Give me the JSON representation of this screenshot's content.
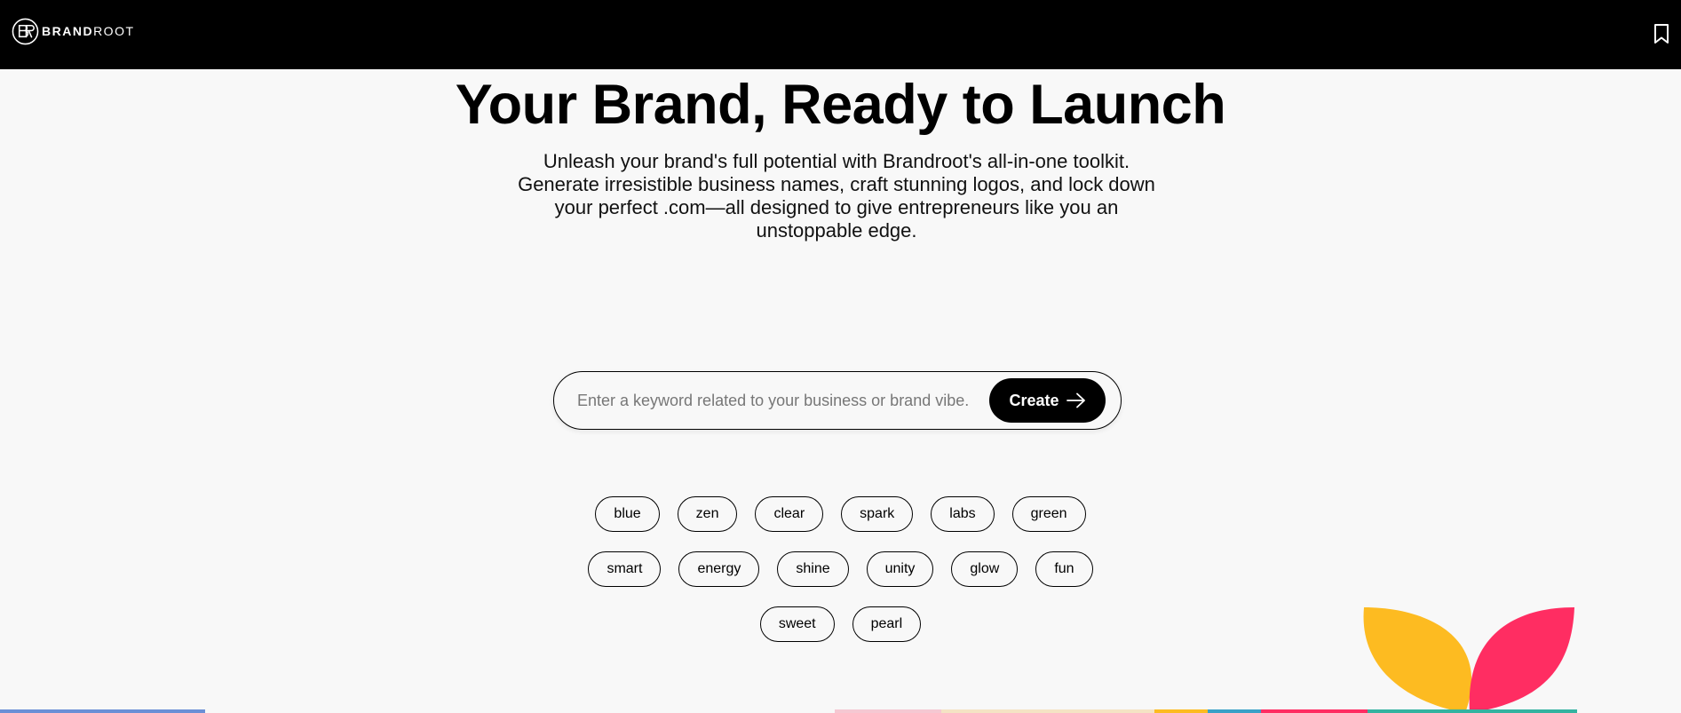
{
  "header": {
    "logo": {
      "bold": "BRAND",
      "light": "ROOT"
    },
    "bookmark_icon": "bookmark-icon"
  },
  "hero": {
    "title": "Your Brand, Ready to Launch",
    "subtitle": "Unleash your brand's full potential with Brandroot's all-in-one toolkit. Generate irresistible business names, craft stunning logos, and lock down your perfect .com—all designed to give entrepreneurs like you an unstoppable edge."
  },
  "search": {
    "placeholder": "Enter a keyword related to your business or brand vibe.",
    "value": "",
    "button_label": "Create",
    "button_icon": "arrow-right-icon"
  },
  "keywords": {
    "rows": [
      [
        "blue",
        "zen",
        "clear",
        "spark",
        "labs",
        "green"
      ],
      [
        "smart",
        "energy",
        "shine",
        "unity",
        "glow",
        "fun"
      ],
      [
        "sweet",
        "pearl"
      ]
    ]
  },
  "colors": {
    "header_bg": "#000000",
    "page_bg": "#f8f8f8",
    "leaf_yellow": "#fdbb21",
    "leaf_pink": "#ff2d62"
  }
}
